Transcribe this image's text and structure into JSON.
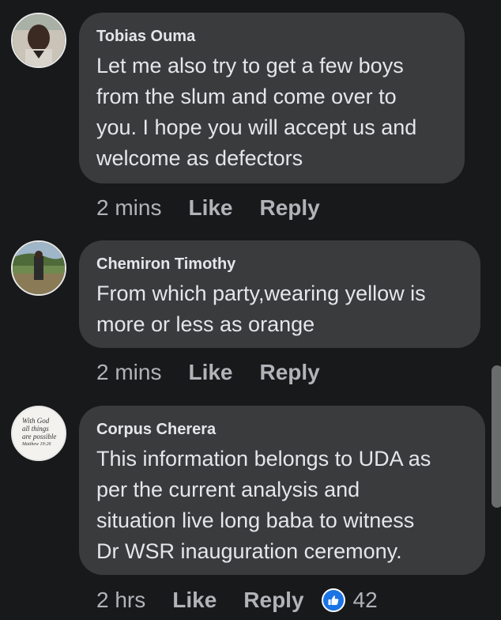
{
  "comments": [
    {
      "author": "Tobias Ouma",
      "lines": [
        "Let me also try to get a few boys",
        "from the slum and come over to",
        "you. I hope you will accept us and",
        "welcome as defectors"
      ],
      "time": "2 mins",
      "like_label": "Like",
      "reply_label": "Reply"
    },
    {
      "author": "Chemiron Timothy",
      "lines": [
        "From which party,wearing yellow is",
        "more or less as orange"
      ],
      "time": "2 mins",
      "like_label": "Like",
      "reply_label": "Reply"
    },
    {
      "author": "Corpus Cherera",
      "avatar_text": [
        "With God",
        "all things",
        "are possible",
        "Matthew 19:26"
      ],
      "lines": [
        "This information belongs to UDA as",
        "per the current analysis and",
        "situation live long baba to witness",
        "Dr WSR inauguration ceremony."
      ],
      "time": "2 hrs",
      "like_label": "Like",
      "reply_label": "Reply",
      "reaction_icon": "thumbs-up-icon",
      "reaction_count": "42"
    }
  ],
  "colors": {
    "background": "#18191a",
    "bubble": "#3a3b3c",
    "text": "#e4e6eb",
    "secondary": "#b0b3b8",
    "like_blue": "#1b74e4"
  }
}
